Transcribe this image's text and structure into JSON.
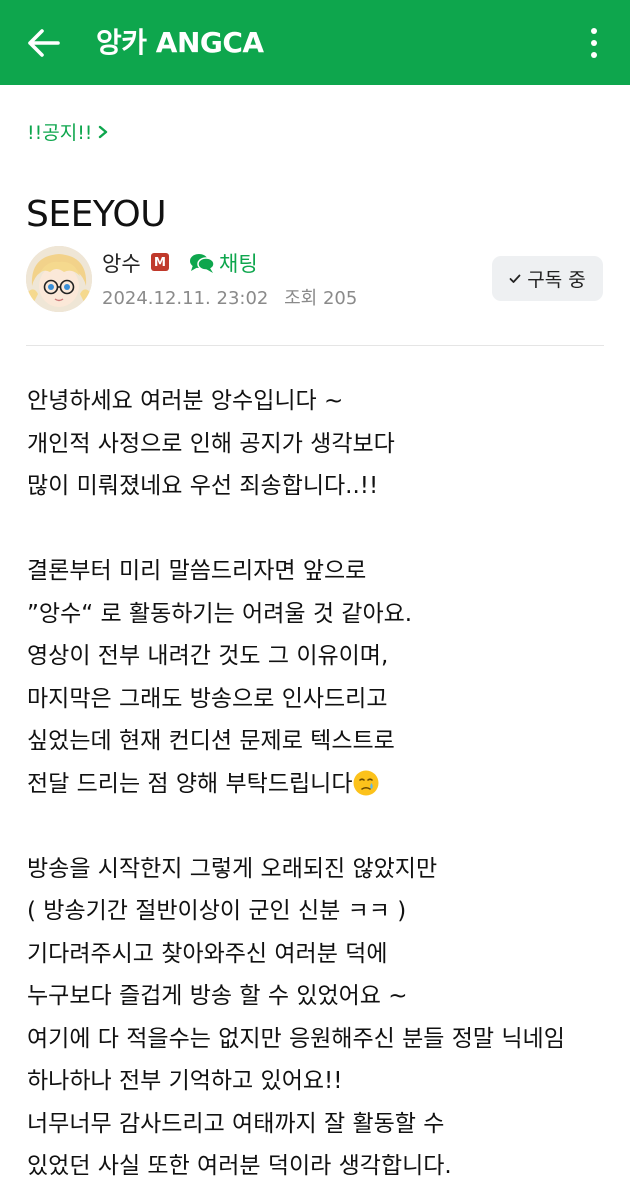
{
  "appbar": {
    "title": "앙카 ANGCA",
    "back_icon": "arrow-left-icon",
    "more_icon": "more-vertical-icon",
    "color": "#0ea64d"
  },
  "post": {
    "board": "!!공지!!",
    "title": "SEEYOU",
    "author": "앙수",
    "manager_badge": "M",
    "chat_label": "채팅",
    "date": "2024.12.11. 23:02",
    "views_label": "조회 205",
    "subscribe_label": "구독 중"
  },
  "content": {
    "paragraphs": [
      [
        "안녕하세요 여러분 앙수입니다 ~",
        "개인적 사정으로 인해 공지가 생각보다",
        "많이 미뤄졌네요 우선 죄송합니다..!!"
      ],
      [
        "결론부터 미리 말씀드리자면 앞으로",
        "”앙수“ 로 활동하기는 어려울 것 같아요.",
        "영상이 전부 내려간 것도 그 이유이며,",
        "마지막은 그래도 방송으로 인사드리고",
        "싶었는데 현재 컨디션 문제로 텍스트로",
        "전달 드리는 점 양해 부탁드립니다"
      ],
      [
        "방송을 시작한지 그렇게 오래되진 않았지만",
        "( 방송기간 절반이상이 군인 신분 ㅋㅋ )",
        "기다려주시고 찾아와주신 여러분 덕에",
        "누구보다 즐겁게 방송 할 수 있었어요 ~",
        "여기에 다 적을수는 없지만 응원해주신 분들 정말 닉네임",
        "하나하나 전부 기억하고 있어요!!",
        "너무너무 감사드리고 여태까지 잘 활동할 수",
        "있었던 사실 또한 여러분 덕이라 생각합니다."
      ]
    ]
  }
}
